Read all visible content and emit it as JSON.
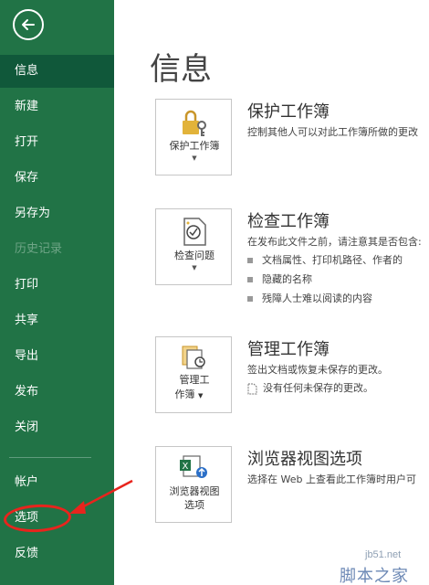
{
  "sidebar": {
    "items": [
      {
        "label": "信息"
      },
      {
        "label": "新建"
      },
      {
        "label": "打开"
      },
      {
        "label": "保存"
      },
      {
        "label": "另存为"
      },
      {
        "label": "历史记录"
      },
      {
        "label": "打印"
      },
      {
        "label": "共享"
      },
      {
        "label": "导出"
      },
      {
        "label": "发布"
      },
      {
        "label": "关闭"
      },
      {
        "label": "帐户"
      },
      {
        "label": "选项"
      },
      {
        "label": "反馈"
      }
    ]
  },
  "main": {
    "title": "信息",
    "protect": {
      "tile_line1": "保护工作簿",
      "title": "保护工作簿",
      "desc": "控制其他人可以对此工作簿所做的更改"
    },
    "inspect": {
      "tile_line1": "检查问题",
      "title": "检查工作簿",
      "desc": "在发布此文件之前，请注意其是否包含:",
      "bullets": [
        "文档属性、打印机路径、作者的",
        "隐藏的名称",
        "残障人士难以阅读的内容"
      ]
    },
    "manage": {
      "tile_line1": "管理工",
      "tile_line2": "作簿",
      "title": "管理工作簿",
      "desc": "签出文档或恢复未保存的更改。",
      "note": "没有任何未保存的更改。"
    },
    "browser": {
      "tile_line1": "浏览器视图",
      "tile_line2": "选项",
      "title": "浏览器视图选项",
      "desc": "选择在 Web 上查看此工作簿时用户可"
    }
  },
  "watermark": {
    "line1": "jb51.net",
    "line2": "脚本之家"
  },
  "colors": {
    "sidebar_bg": "#217346",
    "sidebar_active": "#10583a",
    "annotation": "#e8241d"
  }
}
